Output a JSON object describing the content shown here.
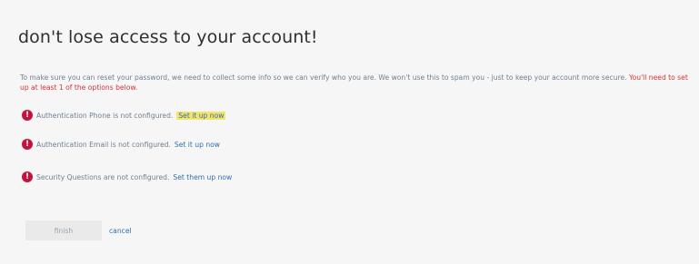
{
  "header": {
    "title": "don't lose access to your account!"
  },
  "intro": {
    "text": "To make sure you can reset your password, we need to collect some info so we can verify who you are. We won't use this to spam you - just to keep your account more secure.",
    "warning": "You'll need to set up at least 1 of the options below."
  },
  "options": [
    {
      "icon": "error-icon",
      "text": "Authentication Phone is not configured.",
      "link": "Set it up now",
      "highlighted": true
    },
    {
      "icon": "error-icon",
      "text": "Authentication Email is not configured.",
      "link": "Set it up now",
      "highlighted": false
    },
    {
      "icon": "error-icon",
      "text": "Security Questions are not configured.",
      "link": "Set them up now",
      "highlighted": false
    }
  ],
  "footer": {
    "finish_label": "finish",
    "cancel_label": "cancel"
  },
  "colors": {
    "error": "#c8103c",
    "link": "#2f6fb0",
    "highlight": "#f5e46a",
    "warning_text": "#d13438"
  }
}
